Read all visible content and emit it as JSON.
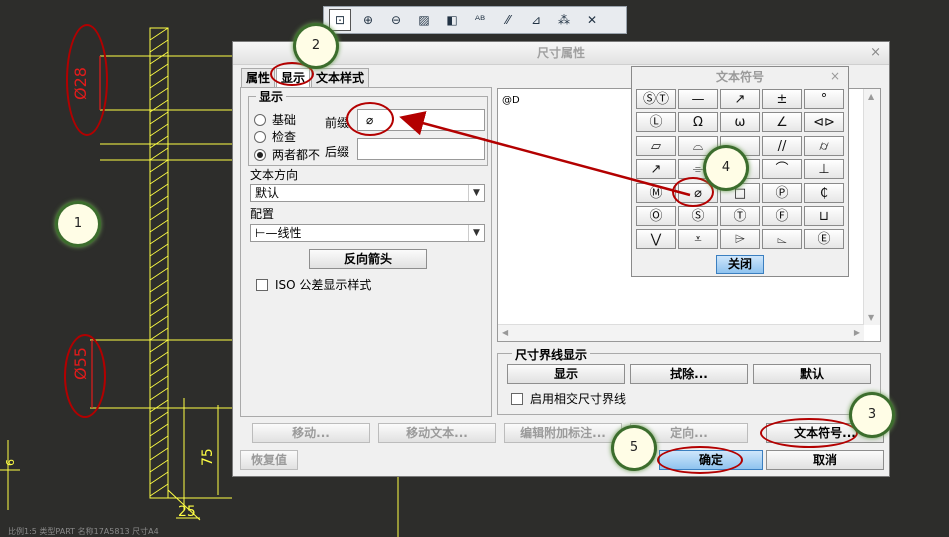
{
  "cad": {
    "dim_top": "Ø28",
    "dim_bottom": "Ø55",
    "dim_75": "75",
    "dim_25": "25",
    "left_label": "6",
    "status_bar": "比例1:5    类型PART  名称17A5813   尺寸A4"
  },
  "toolbar": {
    "icons": [
      "zoom-window-icon",
      "zoom-in-icon",
      "zoom-out-icon",
      "repaint-icon",
      "shade-icon",
      "annotation-icon",
      "datum-plane-icon",
      "datum-axis-icon",
      "datum-point-icon",
      "coord-sys-icon"
    ]
  },
  "dialog": {
    "title": "尺寸属性",
    "close": "×",
    "tabs": [
      "属性",
      "显示",
      "文本样式"
    ],
    "display_group": "显示",
    "radio_basic": "基础",
    "radio_inspect": "检查",
    "radio_neither": "两者都不",
    "prefix_label": "前缀",
    "prefix_value": "⌀",
    "suffix_label": "后缀",
    "suffix_value": "",
    "text_dir_label": "文本方向",
    "text_dir_value": "默认",
    "config_label": "配置",
    "config_value": "⊢—线性",
    "flip_arrows": "反向箭头",
    "iso_tolerance": "ISO 公差显示样式",
    "text_content": "@D",
    "ext_lines_group": "尺寸界线显示",
    "btn_show": "显示",
    "btn_erase": "拭除...",
    "btn_default": "默认",
    "intersect_lines": "启用相交尺寸界线",
    "btn_move": "移动...",
    "btn_move_text": "移动文本...",
    "btn_edit_attach": "编辑附加标注...",
    "btn_orient": "定向...",
    "btn_text_symbol": "文本符号...",
    "btn_restore": "恢复值",
    "btn_ok": "确定",
    "btn_cancel": "取消"
  },
  "palette": {
    "title": "文本符号",
    "close": "×",
    "close_btn": "关闭",
    "symbols": [
      "ⓈⓉ",
      "—",
      "↗",
      "±",
      "°",
      "Ⓛ",
      "Ω",
      "ω",
      "∠",
      "⊲⊳",
      "▱",
      "⌓",
      "",
      "//",
      "⌭",
      "↗",
      "⌯",
      "",
      "⌒",
      "⊥",
      "Ⓜ",
      "⌀",
      "□",
      "Ⓟ",
      "₵",
      "Ⓞ",
      "Ⓢ",
      "Ⓣ",
      "Ⓕ",
      "⊔",
      "⋁",
      "⩡",
      "⌲",
      "⌳",
      "Ⓔ"
    ]
  },
  "callouts": [
    "1",
    "2",
    "3",
    "4",
    "5"
  ],
  "colors": {
    "annotation": "#b30000",
    "cad_bg": "#2d2d2b",
    "cad_yellow": "#ffff44",
    "cad_red": "#e21b1b"
  }
}
